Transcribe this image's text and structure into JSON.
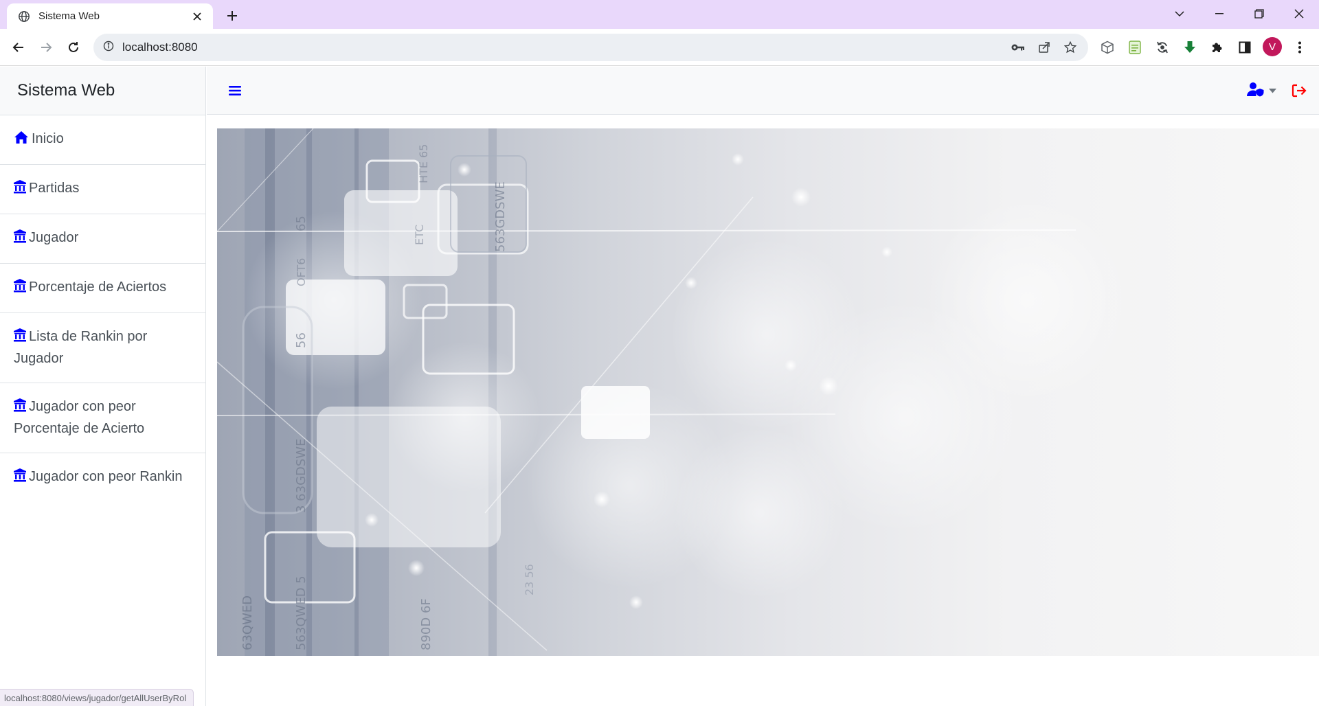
{
  "browser": {
    "tab_title": "Sistema Web",
    "url": "localhost:8080",
    "profile_initial": "V",
    "status_url": "localhost:8080/views/jugador/getAllUserByRol"
  },
  "sidebar": {
    "brand": "Sistema Web",
    "items": [
      {
        "label": "Inicio",
        "icon": "home-icon"
      },
      {
        "label": "Partidas",
        "icon": "landmark-icon"
      },
      {
        "label": "Jugador",
        "icon": "landmark-icon"
      },
      {
        "label": "Porcentaje de Aciertos",
        "icon": "landmark-icon"
      },
      {
        "label": "Lista de Rankin por Jugador",
        "icon": "landmark-icon"
      },
      {
        "label": "Jugador con peor Porcentaje de Acierto",
        "icon": "landmark-icon"
      },
      {
        "label": "Jugador con peor Rankin",
        "icon": "landmark-icon"
      }
    ]
  },
  "topnav": {
    "menu_toggle_icon": "bars-icon",
    "user_icon": "user-shield-icon",
    "logout_icon": "sign-out-icon"
  },
  "colors": {
    "accent": "#0000ff",
    "logout": "#ff0000",
    "tabstrip": "#e9d8fb",
    "profile": "#c2185b"
  },
  "hero_image": {
    "texts": [
      "63QWED",
      "563QWED 5",
      "3 63GDSWE",
      "563GDSWE",
      "890D 6F",
      "56",
      "65",
      "23 56",
      "OFT6",
      "ETC",
      "HTE 65"
    ]
  }
}
